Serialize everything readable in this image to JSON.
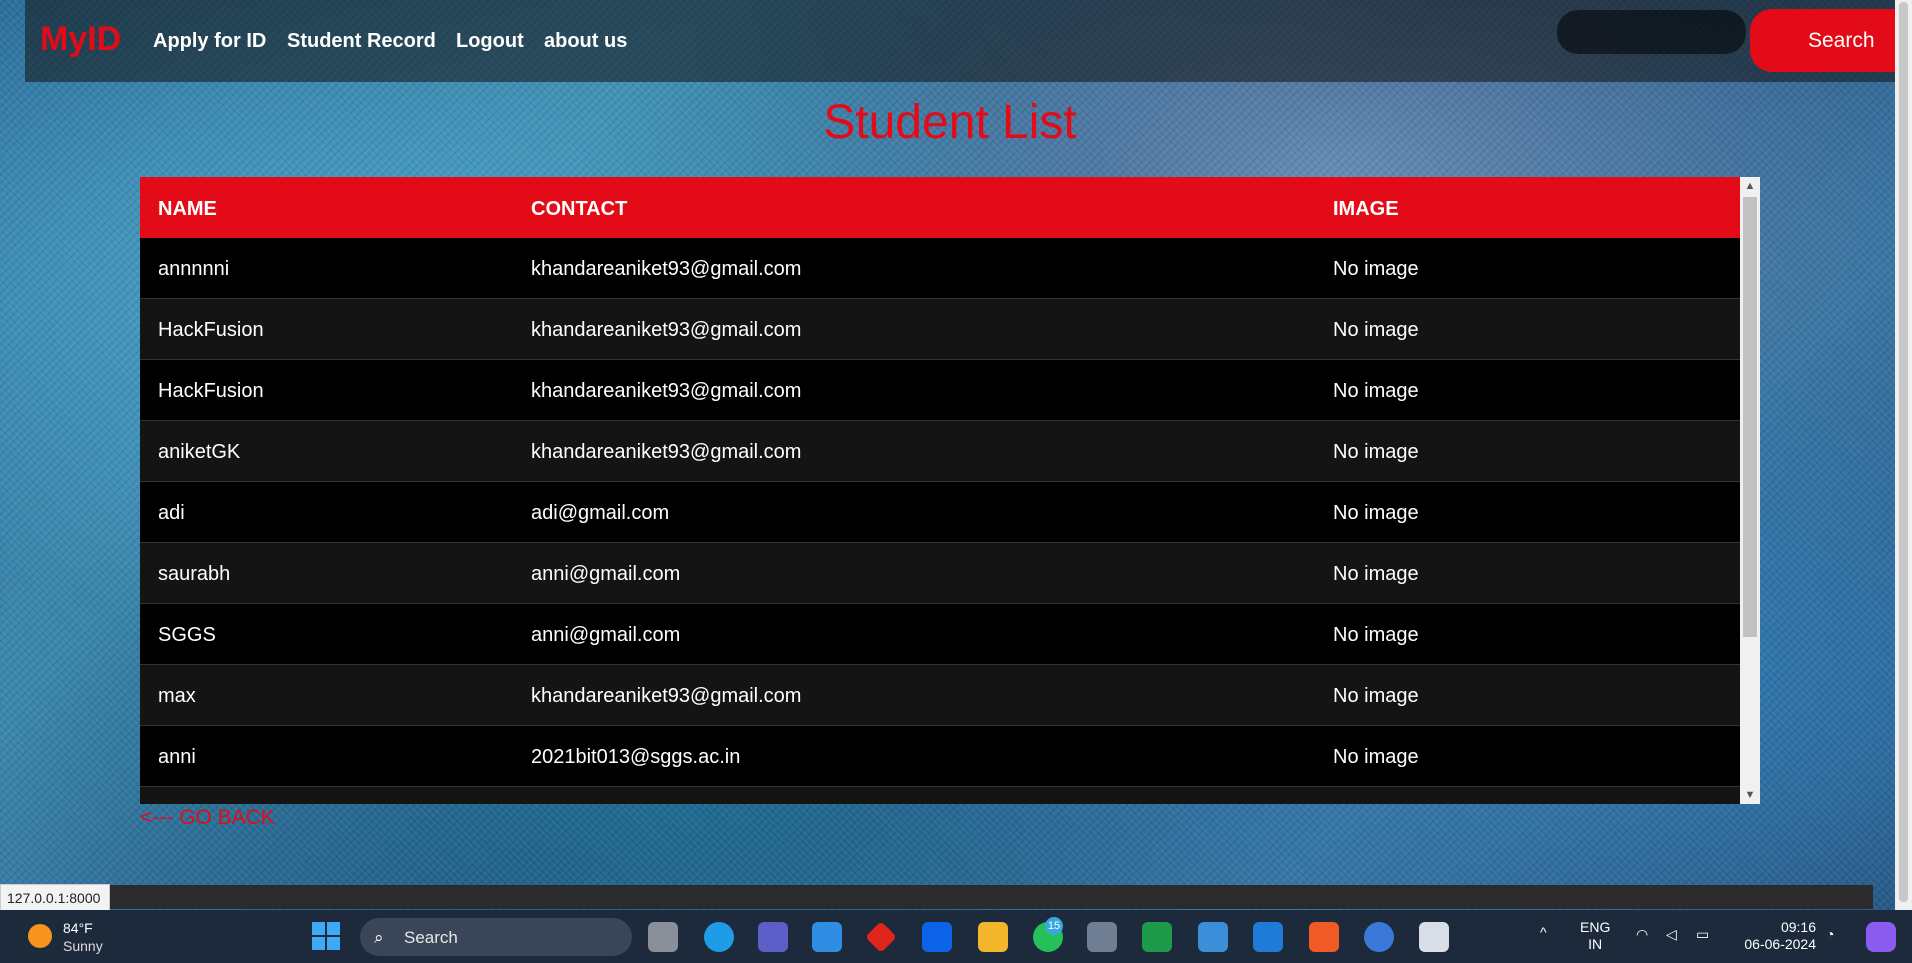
{
  "nav": {
    "brand": "MyID",
    "links": [
      "Apply for ID",
      "Student Record",
      "Logout",
      "about us"
    ],
    "search_label": "Search"
  },
  "page": {
    "title": "Student List",
    "go_back": "<--- GO BACK"
  },
  "table": {
    "headers": [
      "NAME",
      "CONTACT",
      "IMAGE"
    ],
    "rows": [
      [
        "annnnni",
        "khandareaniket93@gmail.com",
        "No image"
      ],
      [
        "HackFusion",
        "khandareaniket93@gmail.com",
        "No image"
      ],
      [
        "HackFusion",
        "khandareaniket93@gmail.com",
        "No image"
      ],
      [
        "aniketGK",
        "khandareaniket93@gmail.com",
        "No image"
      ],
      [
        "adi",
        "adi@gmail.com",
        "No image"
      ],
      [
        "saurabh",
        "anni@gmail.com",
        "No image"
      ],
      [
        "SGGS",
        "anni@gmail.com",
        "No image"
      ],
      [
        "max",
        "khandareaniket93@gmail.com",
        "No image"
      ],
      [
        "anni",
        "2021bit013@sggs.ac.in",
        "No image"
      ]
    ]
  },
  "status_url": "127.0.0.1:8000",
  "taskbar": {
    "temp": "84°F",
    "weather": "Sunny",
    "search": "Search",
    "whatsapp_badge": "15",
    "lang_top": "ENG",
    "lang_bottom": "IN",
    "time": "09:16",
    "date": "06-06-2024"
  },
  "colors": {
    "accent": "#e30b17",
    "table_bg": "#000000",
    "taskbar_bg": "#1c2a3c"
  }
}
